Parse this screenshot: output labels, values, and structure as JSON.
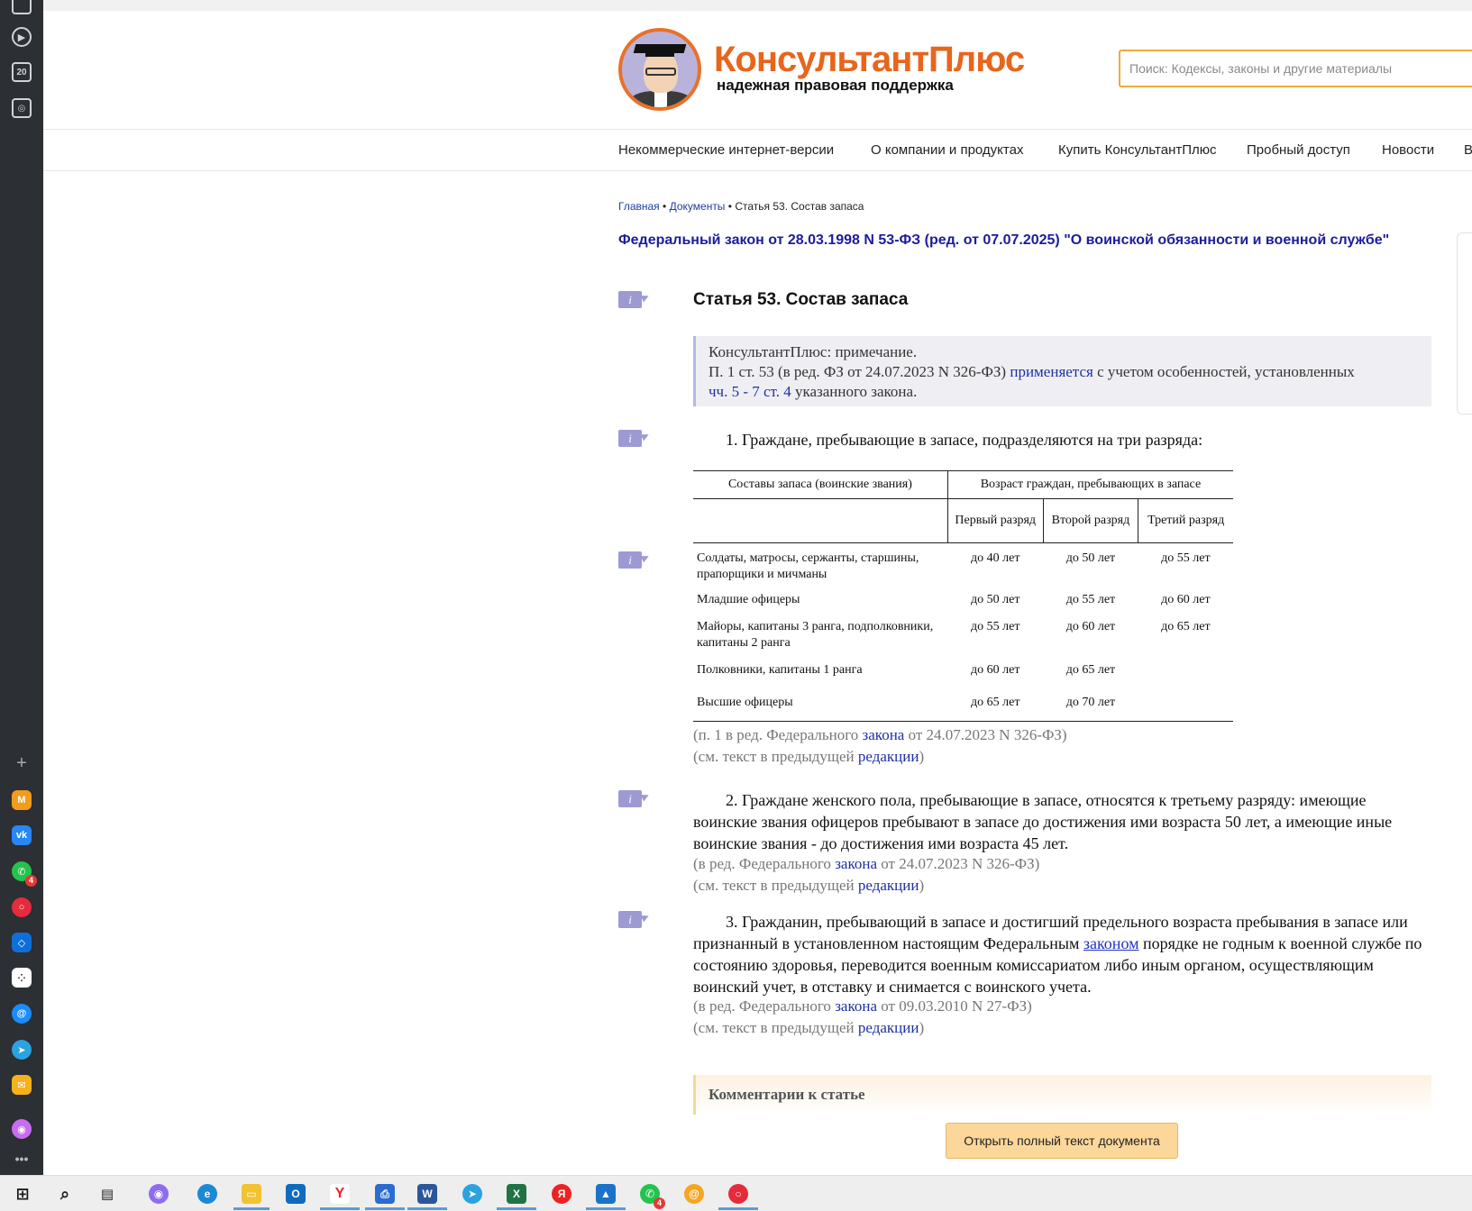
{
  "colors": {
    "brand_orange": "#e8651c",
    "link_blue": "#1f30a3",
    "title_blue": "#1c1c9c",
    "info_icon": "#9d9ad3",
    "button": "#fcd79a",
    "search_border": "#f0a93a"
  },
  "sidebar": {
    "calendar_badge": "20",
    "whatsapp_badge": "4"
  },
  "header": {
    "brand_name": "КонсультантПлюс",
    "tagline": "надежная правовая поддержка",
    "search_placeholder": "Поиск: Кодексы, законы и другие материалы"
  },
  "nav": {
    "items": [
      "Некоммерческие интернет-версии",
      "О компании и продуктах",
      "Купить КонсультантПлюс",
      "Пробный доступ",
      "Новости",
      "В"
    ]
  },
  "breadcrumb": {
    "home": "Главная",
    "docs": "Документы",
    "sep": "•",
    "current": "Статья 53. Состав запаса"
  },
  "doc_title": "Федеральный закон от 28.03.1998 N 53-ФЗ (ред. от 07.07.2025) \"О воинской обязанности и военной службе\"",
  "article": {
    "title": "Статья 53. Состав запаса",
    "note": {
      "line1": "КонсультантПлюс: примечание.",
      "line2_a": "П. 1 ст. 53 (в ред. ФЗ от 24.07.2023 N 326-ФЗ)",
      "line2_link": "применяется",
      "line2_b": "с учетом особенностей, установленных",
      "line3_link": "чч. 5 - 7 ст. 4",
      "line3_b": "указанного закона."
    },
    "p1": "1. Граждане, пребывающие в запасе, подразделяются на три разряда:",
    "table": {
      "h_composition": "Составы запаса (воинские звания)",
      "h_age": "Возраст граждан, пребывающих в запасе",
      "h_first": "Первый разряд",
      "h_second": "Второй разряд",
      "h_third": "Третий разряд",
      "rows": [
        {
          "name": "Солдаты, матросы, сержанты, старшины, прапорщики и мичманы",
          "a": "до 40 лет",
          "b": "до 50 лет",
          "c": "до 55 лет"
        },
        {
          "name": "Младшие офицеры",
          "a": "до 50 лет",
          "b": "до 55 лет",
          "c": "до 60 лет"
        },
        {
          "name": "Майоры, капитаны 3 ранга, подполковники, капитаны 2 ранга",
          "a": "до 55 лет",
          "b": "до 60 лет",
          "c": "до 65 лет"
        },
        {
          "name": "Полковники, капитаны 1 ранга",
          "a": "до 60 лет",
          "b": "до 65 лет",
          "c": ""
        },
        {
          "name": "Высшие офицеры",
          "a": "до 65 лет",
          "b": "до 70 лет",
          "c": ""
        }
      ]
    },
    "p1_ed_a": "(п. 1 в ред. Федерального",
    "p1_ed_link": "закона",
    "p1_ed_b": "от 24.07.2023 N 326-ФЗ)",
    "see_a": "(см. текст в предыдущей",
    "see_link": "редакции",
    "see_b": ")",
    "p2": "2. Граждане женского пола, пребывающие в запасе, относятся к третьему разряду: имеющие воинские звания офицеров пребывают в запасе до достижения ими возраста 50 лет, а имеющие иные воинские звания - до достижения ими возраста 45 лет.",
    "p2_ed_a": "(в ред. Федерального",
    "p2_ed_link": "закона",
    "p2_ed_b": "от 24.07.2023 N 326-ФЗ)",
    "p3_a": "3. Гражданин, пребывающий в запасе и достигший предельного возраста пребывания в запасе или признанный в установленном настоящим Федеральным",
    "p3_link": "законом",
    "p3_b": "порядке не годным к военной службе по состоянию здоровья, переводится военным комиссариатом либо иным органом, осуществляющим воинский учет, в отставку и снимается с воинского учета.",
    "p3_ed_a": "(в ред. Федерального",
    "p3_ed_link": "закона",
    "p3_ed_b": "от 09.03.2010 N 27-ФЗ)"
  },
  "comments_title": "Комментарии к статье",
  "open_button": "Открыть полный текст документа",
  "taskbar": {
    "whatsapp_badge": "4",
    "yandex_letter": "Я"
  }
}
